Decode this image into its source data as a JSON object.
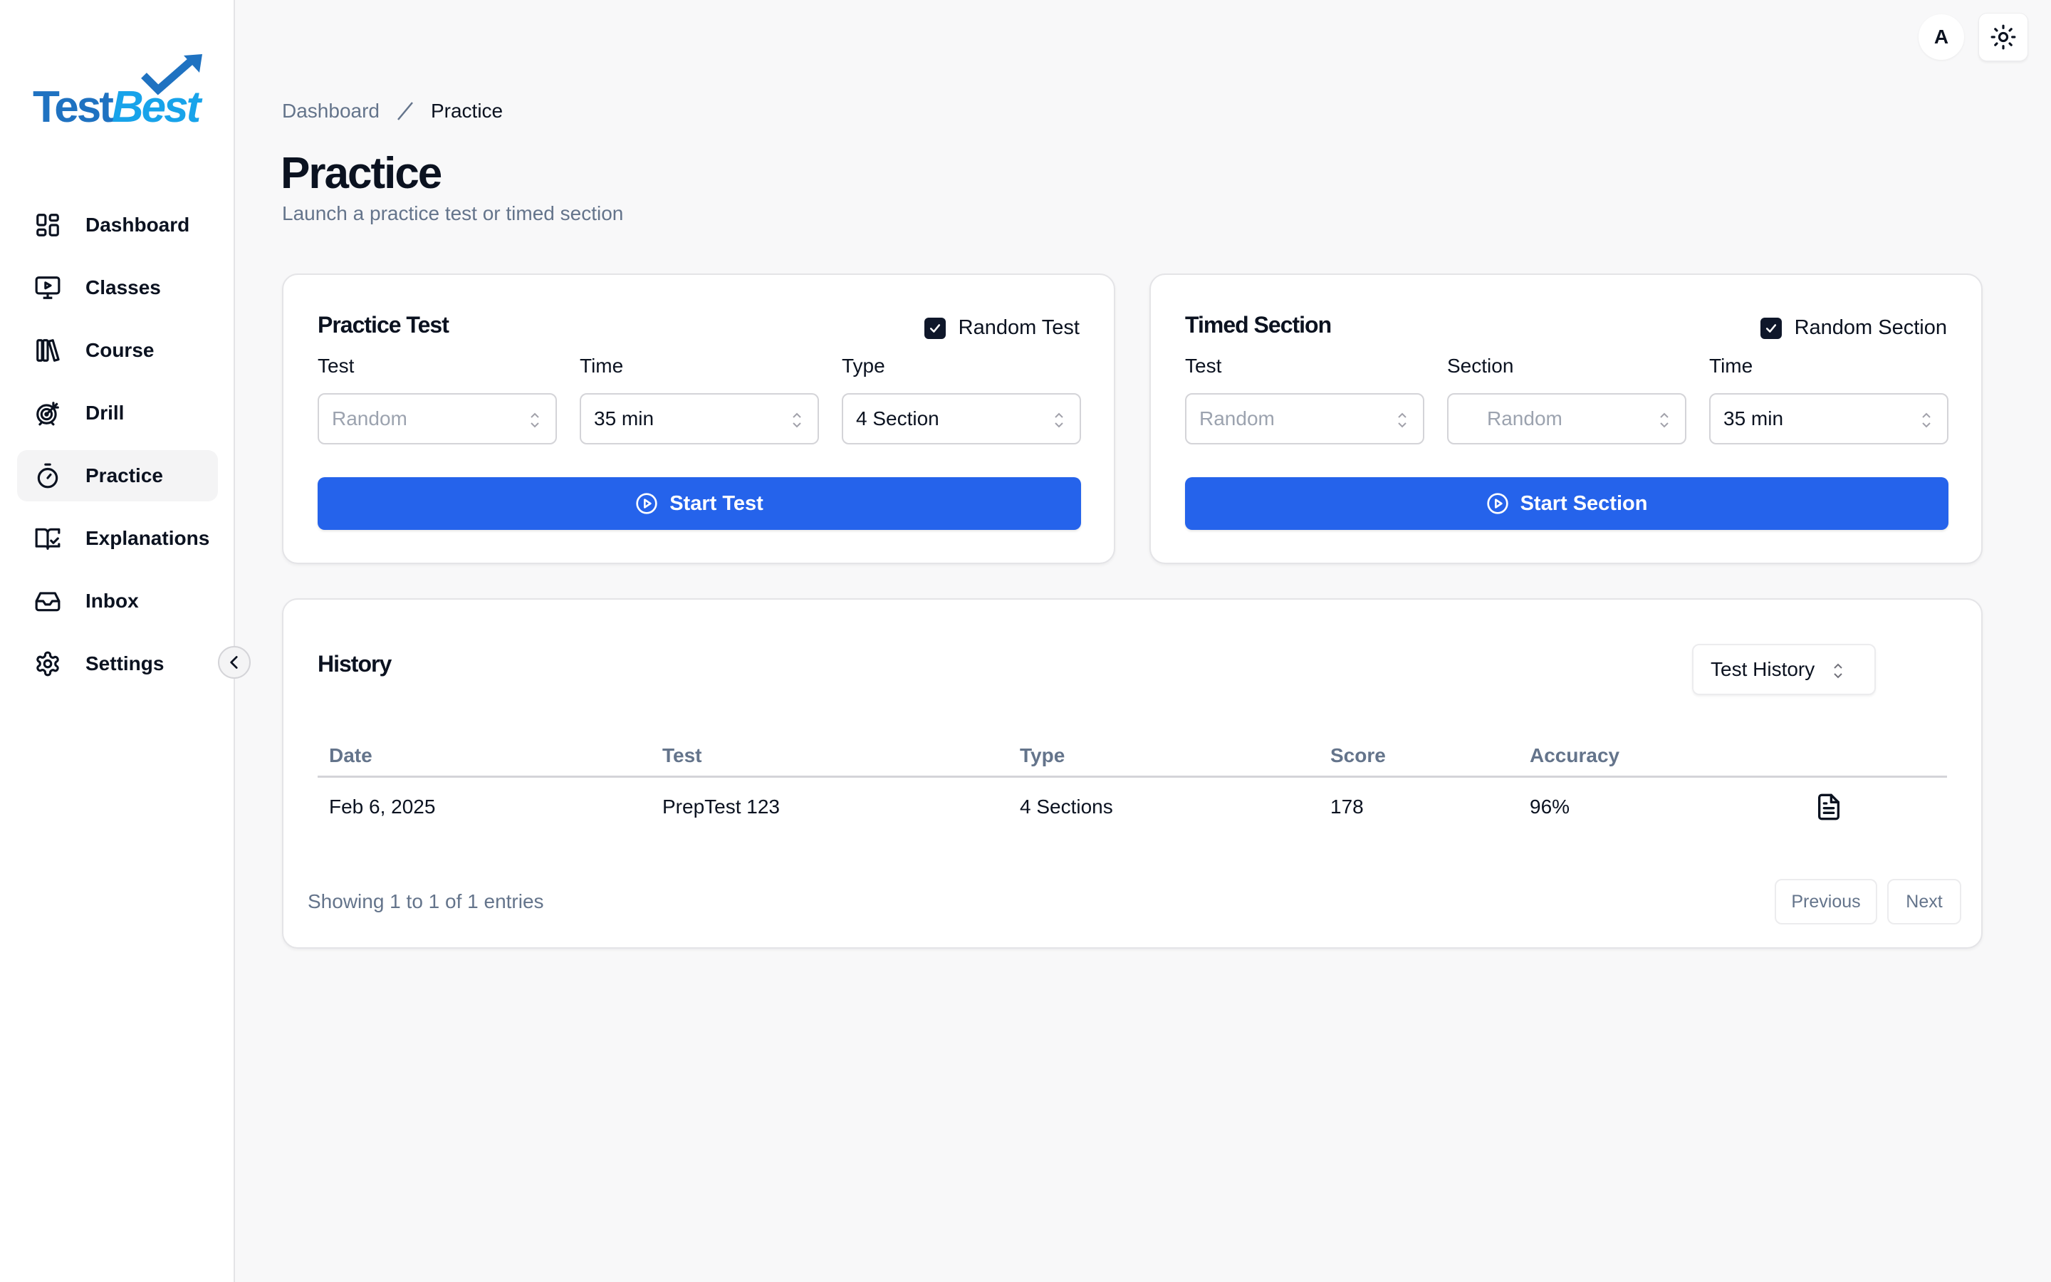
{
  "brand": {
    "part1": "Test",
    "part2": "Best",
    "color1": "#1f72c1",
    "color2": "#18a3ea"
  },
  "sidebar": {
    "items": [
      {
        "label": "Dashboard",
        "icon": "layout-grid-icon",
        "active": false
      },
      {
        "label": "Classes",
        "icon": "monitor-play-icon",
        "active": false
      },
      {
        "label": "Course",
        "icon": "library-icon",
        "active": false
      },
      {
        "label": "Drill",
        "icon": "target-arrow-icon",
        "active": false
      },
      {
        "label": "Practice",
        "icon": "timer-icon",
        "active": true
      },
      {
        "label": "Explanations",
        "icon": "book-check-icon",
        "active": false
      },
      {
        "label": "Inbox",
        "icon": "inbox-icon",
        "active": false
      },
      {
        "label": "Settings",
        "icon": "gear-icon",
        "active": false
      }
    ],
    "collapse_icon": "chevron-left-icon"
  },
  "topbar": {
    "avatar_initial": "A",
    "theme_icon": "sun-icon"
  },
  "breadcrumb": {
    "parent": "Dashboard",
    "current": "Practice"
  },
  "header": {
    "title": "Practice",
    "subtitle": "Launch a practice test or timed section"
  },
  "practice_test": {
    "title": "Practice Test",
    "random_label": "Random Test",
    "random_checked": true,
    "fields": [
      {
        "label": "Test",
        "value": "Random",
        "placeholder": true
      },
      {
        "label": "Time",
        "value": "35 min",
        "placeholder": false
      },
      {
        "label": "Type",
        "value": "4 Section",
        "placeholder": false
      }
    ],
    "button_label": "Start Test"
  },
  "timed_section": {
    "title": "Timed Section",
    "random_label": "Random Section",
    "random_checked": true,
    "fields": [
      {
        "label": "Test",
        "value": "Random",
        "placeholder": true
      },
      {
        "label": "Section",
        "value": "Random",
        "placeholder": true
      },
      {
        "label": "Time",
        "value": "35 min",
        "placeholder": false
      }
    ],
    "button_label": "Start Section"
  },
  "history": {
    "title": "History",
    "filter_value": "Test History",
    "columns": [
      "Date",
      "Test",
      "Type",
      "Score",
      "Accuracy"
    ],
    "rows": [
      {
        "date": "Feb 6, 2025",
        "test": "PrepTest 123",
        "type": "4 Sections",
        "score": "178",
        "accuracy": "96%",
        "action_icon": "file-text-icon"
      }
    ],
    "footer": "Showing 1 to 1 of 1 entries",
    "prev_label": "Previous",
    "next_label": "Next"
  },
  "colors": {
    "primary": "#2563eb",
    "text": "#0b1220",
    "muted": "#64748b",
    "checkbox": "#0f172a"
  }
}
